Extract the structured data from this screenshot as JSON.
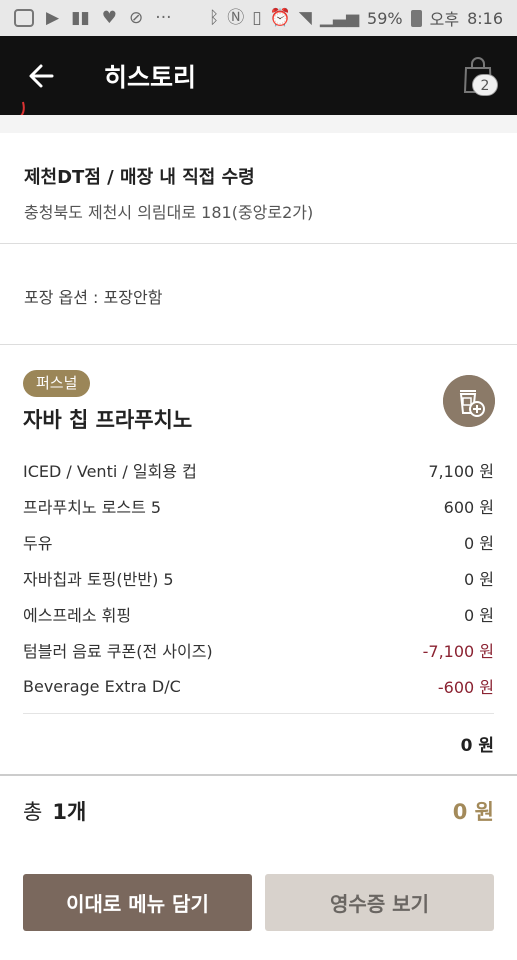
{
  "status_bar": {
    "battery": "59%",
    "period": "오후",
    "time": "8:16",
    "icons": [
      "u-icon",
      "play-icon",
      "chart-icon",
      "heart-icon",
      "wifi-off-icon",
      "more-icon",
      "bluetooth-icon",
      "nfc-icon",
      "vibrate-icon",
      "alarm-icon",
      "wifi-icon",
      "signal-icon",
      "battery-icon"
    ]
  },
  "header": {
    "title": "히스토리",
    "cart_count": "2"
  },
  "store": {
    "name": "제천DT점 / 매장 내 직접 수령",
    "address": "충청북도 제천시 의림대로 181(중앙로2가)"
  },
  "packaging": {
    "text": "포장 옵션 : 포장안함"
  },
  "item": {
    "badge": "퍼스널",
    "name": "자바 칩 프라푸치노",
    "options": [
      {
        "name": "ICED / Venti / 일회용 컵",
        "price": "7,100 원"
      },
      {
        "name": "프라푸치노 로스트 5",
        "price": "600 원"
      },
      {
        "name": "두유",
        "price": "0 원"
      },
      {
        "name": "자바칩과 토핑(반반) 5",
        "price": "0 원"
      },
      {
        "name": "에스프레소 휘핑",
        "price": "0 원"
      },
      {
        "name": "텀블러 음료 쿠폰(전 사이즈)",
        "price": "-7,100 원"
      },
      {
        "name": "Beverage Extra D/C",
        "price": "-600 원"
      }
    ],
    "subtotal": "0 원"
  },
  "total": {
    "label": "총",
    "count": "1개",
    "price": "0 원"
  },
  "buttons": {
    "add_menu": "이대로 메뉴 담기",
    "receipt": "영수증 보기"
  },
  "colors": {
    "header_bg": "#111111",
    "badge": "#9b8658",
    "discount": "#8b2332",
    "total_price": "#a38a5a",
    "primary_button": "#7a685d",
    "secondary_button": "#d8d2cc"
  }
}
